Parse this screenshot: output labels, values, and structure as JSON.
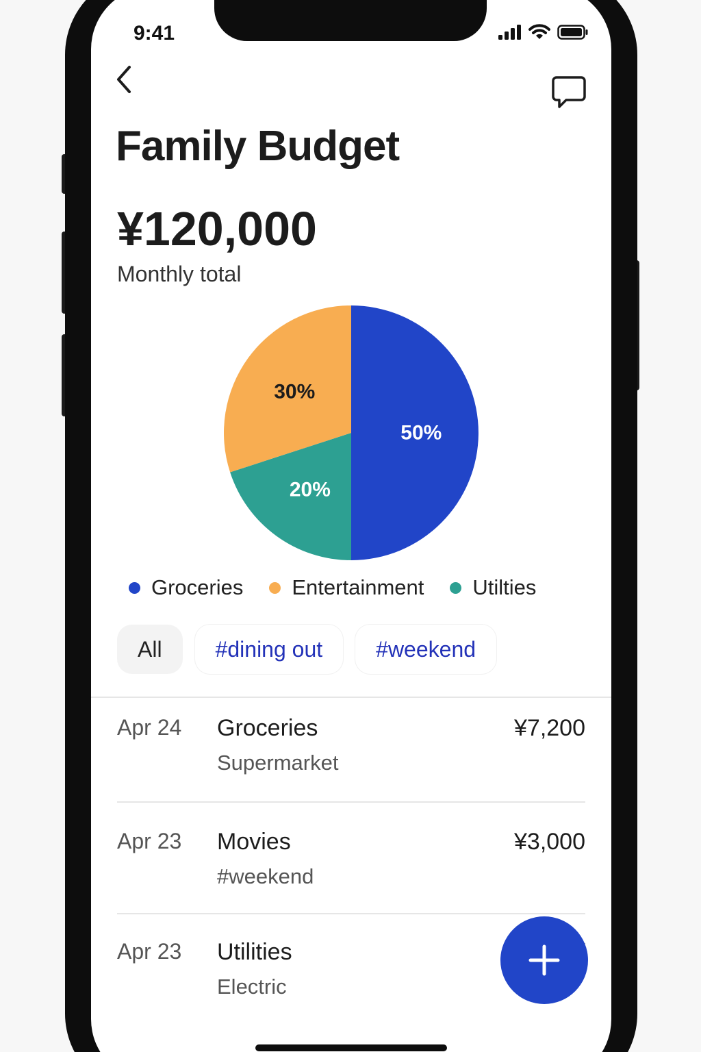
{
  "status_bar": {
    "time": "9:41"
  },
  "header": {
    "back_icon": "chevron-left-icon",
    "chat_icon": "chat-bubble-icon"
  },
  "title": "Family Budget",
  "summary": {
    "total": "¥120,000",
    "label": "Monthly total"
  },
  "chart_data": {
    "type": "pie",
    "slices": [
      {
        "label": "Groceries",
        "value": 50,
        "display": "50%",
        "color": "#2145c8",
        "text_color": "#ffffff"
      },
      {
        "label": "Utilties",
        "value": 20,
        "display": "20%",
        "color": "#2da092",
        "text_color": "#ffffff"
      },
      {
        "label": "Entertainment",
        "value": 30,
        "display": "30%",
        "color": "#f8ad51",
        "text_color": "#1c1c1c"
      }
    ],
    "legend": [
      {
        "label": "Groceries",
        "color": "#2145c8"
      },
      {
        "label": "Entertainment",
        "color": "#f8ad51"
      },
      {
        "label": "Utilties",
        "color": "#2da092"
      }
    ]
  },
  "filters": [
    {
      "label": "All",
      "active": true
    },
    {
      "label": "#dining out",
      "active": false
    },
    {
      "label": "#weekend",
      "active": false
    }
  ],
  "transactions": [
    {
      "date": "Apr 24",
      "name": "Groceries",
      "sub": "Supermarket",
      "amount": "¥7,200"
    },
    {
      "date": "Apr 23",
      "name": "Movies",
      "sub": "#weekend",
      "amount": "¥3,000"
    },
    {
      "date": "Apr 23",
      "name": "Utilities",
      "sub": "Electric",
      "amount": "¥"
    }
  ],
  "fab": {
    "icon": "plus-icon"
  },
  "colors": {
    "accent": "#2145c8",
    "tag": "#2332b8"
  }
}
